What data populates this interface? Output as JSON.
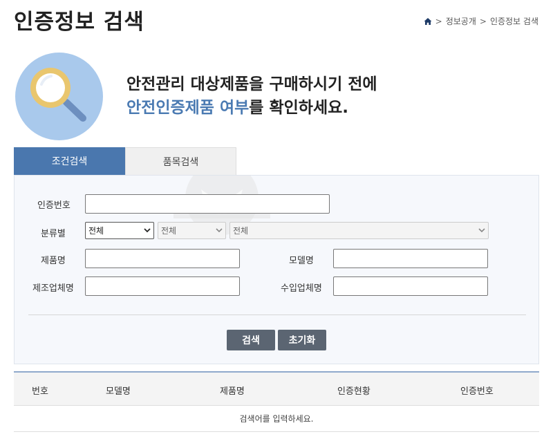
{
  "page": {
    "title": "인증정보 검색"
  },
  "breadcrumb": {
    "home_icon": "home-icon",
    "items": [
      "정보공개",
      "인증정보 검색"
    ],
    "separator": ">"
  },
  "intro": {
    "icon": "magnifier-icon",
    "line1": "안전관리 대상제품을 구매하시기 전에",
    "line2_highlight": "안전인증제품 여부",
    "line2_rest": "를 확인하세요."
  },
  "tabs": [
    {
      "label": "조건검색",
      "active": true
    },
    {
      "label": "품목검색",
      "active": false
    }
  ],
  "form": {
    "cert_no_label": "인증번호",
    "cert_no_value": "",
    "category_label": "분류별",
    "category_selects": [
      "전체",
      "전체",
      "전체"
    ],
    "product_name_label": "제품명",
    "product_name_value": "",
    "model_name_label": "모델명",
    "model_name_value": "",
    "manufacturer_label": "제조업체명",
    "manufacturer_value": "",
    "importer_label": "수입업체명",
    "importer_value": ""
  },
  "buttons": {
    "search": "검색",
    "reset": "초기화"
  },
  "results": {
    "columns": [
      "번호",
      "모델명",
      "제품명",
      "인증현황",
      "인증번호"
    ],
    "empty_message": "검색어를 입력하세요."
  },
  "colors": {
    "accent": "#4a77ae",
    "highlight": "#4a7ab2",
    "button": "#5b6572",
    "circle": "#a9c9ec"
  }
}
